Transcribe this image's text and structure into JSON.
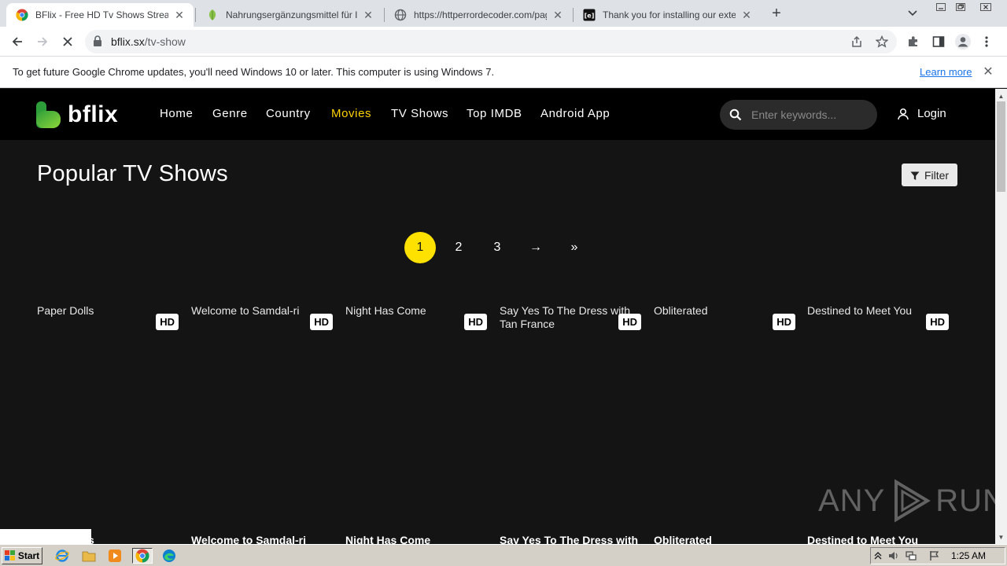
{
  "browser": {
    "tabs": [
      {
        "title": "BFlix - Free HD Tv Shows Streaming",
        "active": true,
        "favicon": "chrome-icon"
      },
      {
        "title": "Nahrungsergänzungsmittel für Ihre Gesundheit",
        "active": false,
        "favicon": "leaf-icon"
      },
      {
        "title": "https://httperrordecoder.com/page/",
        "active": false,
        "favicon": "globe-icon"
      },
      {
        "title": "Thank you for installing our extension",
        "active": false,
        "favicon": "extension-logo-icon"
      }
    ],
    "new_tab_label": "+",
    "address": {
      "domain": "bflix.sx",
      "path": "/tv-show"
    }
  },
  "infobar": {
    "message": "To get future Google Chrome updates, you'll need Windows 10 or later. This computer is using Windows 7.",
    "link": "Learn more"
  },
  "site": {
    "logo_text": "bflix",
    "nav": [
      {
        "label": "Home",
        "active": false
      },
      {
        "label": "Genre",
        "active": false
      },
      {
        "label": "Country",
        "active": false
      },
      {
        "label": "Movies",
        "active": true
      },
      {
        "label": "TV Shows",
        "active": false
      },
      {
        "label": "Top IMDB",
        "active": false
      },
      {
        "label": "Android App",
        "active": false
      }
    ],
    "search_placeholder": "Enter keywords...",
    "login_label": "Login",
    "page_title": "Popular TV Shows",
    "filter_label": "Filter",
    "pagination": [
      {
        "label": "1",
        "current": true
      },
      {
        "label": "2",
        "current": false
      },
      {
        "label": "3",
        "current": false
      },
      {
        "label": "→",
        "current": false
      },
      {
        "label": "»",
        "current": false
      }
    ],
    "cards": [
      {
        "alt": "Paper Dolls",
        "badge": "HD",
        "name": "s"
      },
      {
        "alt": "Welcome to Samdal-ri",
        "badge": "HD",
        "name": "Welcome to Samdal-ri"
      },
      {
        "alt": "Night Has Come",
        "badge": "HD",
        "name": "Night Has Come"
      },
      {
        "alt": "Say Yes To The Dress with Tan France",
        "badge": "HD",
        "name": "Say Yes To The Dress with ..."
      },
      {
        "alt": "Obliterated",
        "badge": "HD",
        "name": "Obliterated"
      },
      {
        "alt": "Destined to Meet You",
        "badge": "HD",
        "name": "Destined to Meet You"
      }
    ],
    "accent_color": "#ffd200",
    "pager_current_color": "#ffe100"
  },
  "watermark": {
    "left": "ANY",
    "right": "RUN"
  },
  "taskbar": {
    "start_label": "Start",
    "apps": [
      "ie-icon",
      "folder-icon",
      "media-player-icon",
      "chrome-icon",
      "edge-icon"
    ],
    "clock": "1:25 AM"
  }
}
